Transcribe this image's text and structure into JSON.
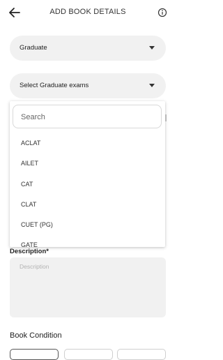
{
  "header": {
    "title": "ADD BOOK DETAILS",
    "back_icon": "arrow-left-icon",
    "info_icon": "info-circle-icon"
  },
  "category_select": {
    "value": "Graduate"
  },
  "exam_select": {
    "value": "Select Graduate exams"
  },
  "dropdown": {
    "search_placeholder": "Search",
    "options": [
      "ACLAT",
      "AILET",
      "CAT",
      "CLAT",
      "CUET (PG)",
      "GATE"
    ]
  },
  "description": {
    "label": "Description*",
    "placeholder": "Description"
  },
  "book_condition": {
    "title": "Book Condition"
  }
}
